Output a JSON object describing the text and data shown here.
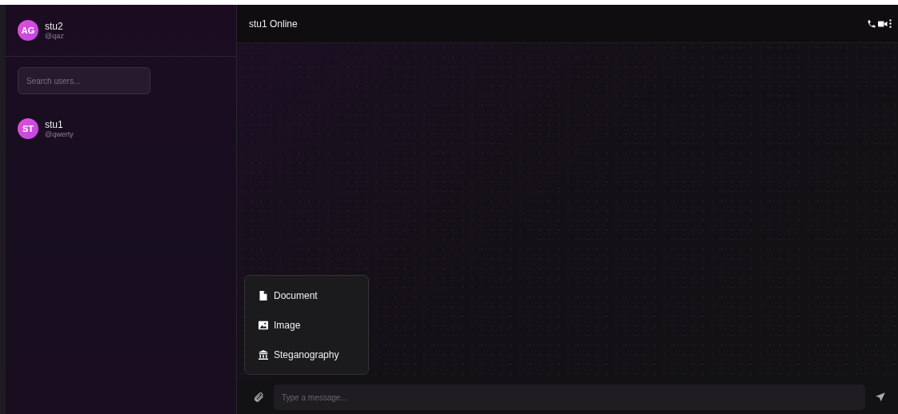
{
  "sidebar": {
    "current_user": {
      "initials": "AG",
      "name": "stu2",
      "handle": "@qaz"
    },
    "search": {
      "placeholder": "Search users..."
    },
    "contacts": [
      {
        "initials": "ST",
        "name": "stu1",
        "handle": "@qwerty"
      }
    ]
  },
  "chat": {
    "title": "stu1 Online",
    "attach_menu": [
      {
        "kind": "document",
        "label": "Document"
      },
      {
        "kind": "image",
        "label": "Image"
      },
      {
        "kind": "steganography",
        "label": "Steganography"
      }
    ],
    "composer": {
      "placeholder": "Type a message..."
    }
  }
}
